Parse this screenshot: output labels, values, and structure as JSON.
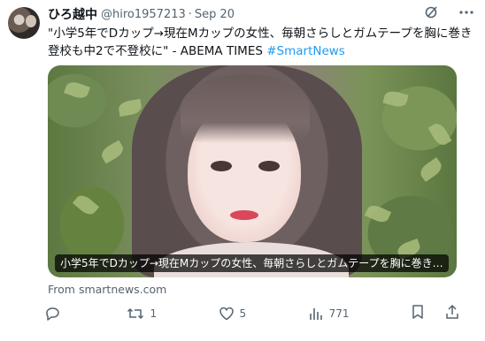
{
  "tweet": {
    "author": {
      "display_name": "ひろ越中",
      "handle": "@hiro1957213",
      "separator": "·",
      "date": "Sep 20"
    },
    "text_prefix": "\"小学5年でDカップ→現在Mカップの女性、毎朝さらしとガムテープを胸に巻き登校も中2で不登校に\" - ABEMA TIMES ",
    "hashtag": "#SmartNews",
    "card": {
      "image_alt_subject": "portrait",
      "caption": "小学5年でDカップ→現在Mカップの女性、毎朝さらしとガムテープを胸に巻き…"
    },
    "source": "From smartnews.com"
  },
  "actions": {
    "reply": {
      "icon": "reply-icon",
      "count": ""
    },
    "retweet": {
      "icon": "retweet-icon",
      "count": "1"
    },
    "like": {
      "icon": "heart-icon",
      "count": "5"
    },
    "views": {
      "icon": "views-icon",
      "count": "771"
    },
    "bookmark": {
      "icon": "bookmark-icon"
    },
    "share": {
      "icon": "share-icon"
    }
  },
  "header_icons": {
    "grok": "grok-icon",
    "more": "more-icon"
  },
  "colors": {
    "text": "#0f1419",
    "muted": "#536471",
    "link": "#1d9bf0"
  }
}
